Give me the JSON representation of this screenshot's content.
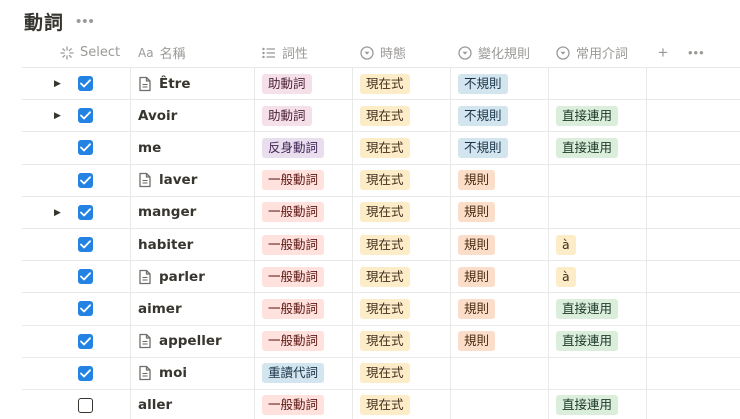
{
  "page": {
    "title": "動詞"
  },
  "columns": {
    "select": "Select",
    "name": "名稱",
    "name_type": "Aa",
    "pos": "詞性",
    "tense": "時態",
    "rule": "變化規則",
    "prep": "常用介詞"
  },
  "colors": {
    "red": {
      "bg": "#ffe2dd",
      "fg": "#5d1715"
    },
    "purple": {
      "bg": "#e8deee",
      "fg": "#412454"
    },
    "blue": {
      "bg": "#d3e5ef",
      "fg": "#183347"
    },
    "yellow": {
      "bg": "#fdecc8",
      "fg": "#402c1b"
    },
    "orange": {
      "bg": "#fadec9",
      "fg": "#49290e"
    },
    "green": {
      "bg": "#dbeddb",
      "fg": "#1c3829"
    },
    "pink": {
      "bg": "#f5e0e9",
      "fg": "#4c2337"
    },
    "accent": "#2383e2"
  },
  "rows": [
    {
      "name": "Être",
      "checked": true,
      "has_toggle": true,
      "has_page_icon": true,
      "pos": {
        "text": "助動詞",
        "color": "pink"
      },
      "tense": {
        "text": "現在式",
        "color": "yellow"
      },
      "rule": {
        "text": "不規則",
        "color": "blue"
      },
      "prep": null
    },
    {
      "name": "Avoir",
      "checked": true,
      "has_toggle": true,
      "has_page_icon": false,
      "pos": {
        "text": "助動詞",
        "color": "pink"
      },
      "tense": {
        "text": "現在式",
        "color": "yellow"
      },
      "rule": {
        "text": "不規則",
        "color": "blue"
      },
      "prep": {
        "text": "直接連用",
        "color": "green"
      }
    },
    {
      "name": "me",
      "checked": true,
      "has_toggle": false,
      "has_page_icon": false,
      "pos": {
        "text": "反身動詞",
        "color": "purple"
      },
      "tense": {
        "text": "現在式",
        "color": "yellow"
      },
      "rule": {
        "text": "不規則",
        "color": "blue"
      },
      "prep": {
        "text": "直接連用",
        "color": "green"
      }
    },
    {
      "name": "laver",
      "checked": true,
      "has_toggle": false,
      "has_page_icon": true,
      "pos": {
        "text": "一般動詞",
        "color": "red"
      },
      "tense": {
        "text": "現在式",
        "color": "yellow"
      },
      "rule": {
        "text": "規則",
        "color": "orange"
      },
      "prep": null
    },
    {
      "name": "manger",
      "checked": true,
      "has_toggle": true,
      "has_page_icon": false,
      "pos": {
        "text": "一般動詞",
        "color": "red"
      },
      "tense": {
        "text": "現在式",
        "color": "yellow"
      },
      "rule": {
        "text": "規則",
        "color": "orange"
      },
      "prep": null
    },
    {
      "name": "habiter",
      "checked": true,
      "has_toggle": false,
      "has_page_icon": false,
      "pos": {
        "text": "一般動詞",
        "color": "red"
      },
      "tense": {
        "text": "現在式",
        "color": "yellow"
      },
      "rule": {
        "text": "規則",
        "color": "orange"
      },
      "prep": {
        "text": "à",
        "color": "yellow"
      }
    },
    {
      "name": "parler",
      "checked": true,
      "has_toggle": false,
      "has_page_icon": true,
      "pos": {
        "text": "一般動詞",
        "color": "red"
      },
      "tense": {
        "text": "現在式",
        "color": "yellow"
      },
      "rule": {
        "text": "規則",
        "color": "orange"
      },
      "prep": {
        "text": "à",
        "color": "yellow"
      }
    },
    {
      "name": "aimer",
      "checked": true,
      "has_toggle": false,
      "has_page_icon": false,
      "pos": {
        "text": "一般動詞",
        "color": "red"
      },
      "tense": {
        "text": "現在式",
        "color": "yellow"
      },
      "rule": {
        "text": "規則",
        "color": "orange"
      },
      "prep": {
        "text": "直接連用",
        "color": "green"
      }
    },
    {
      "name": "appeller",
      "checked": true,
      "has_toggle": false,
      "has_page_icon": true,
      "pos": {
        "text": "一般動詞",
        "color": "red"
      },
      "tense": {
        "text": "現在式",
        "color": "yellow"
      },
      "rule": {
        "text": "規則",
        "color": "orange"
      },
      "prep": {
        "text": "直接連用",
        "color": "green"
      }
    },
    {
      "name": "moi",
      "checked": true,
      "has_toggle": false,
      "has_page_icon": true,
      "pos": {
        "text": "重讀代詞",
        "color": "blue"
      },
      "tense": {
        "text": "現在式",
        "color": "yellow"
      },
      "rule": null,
      "prep": null
    },
    {
      "name": "aller",
      "checked": false,
      "has_toggle": false,
      "has_page_icon": false,
      "pos": {
        "text": "一般動詞",
        "color": "red"
      },
      "tense": {
        "text": "現在式",
        "color": "yellow"
      },
      "rule": null,
      "prep": {
        "text": "直接連用",
        "color": "green"
      }
    }
  ]
}
